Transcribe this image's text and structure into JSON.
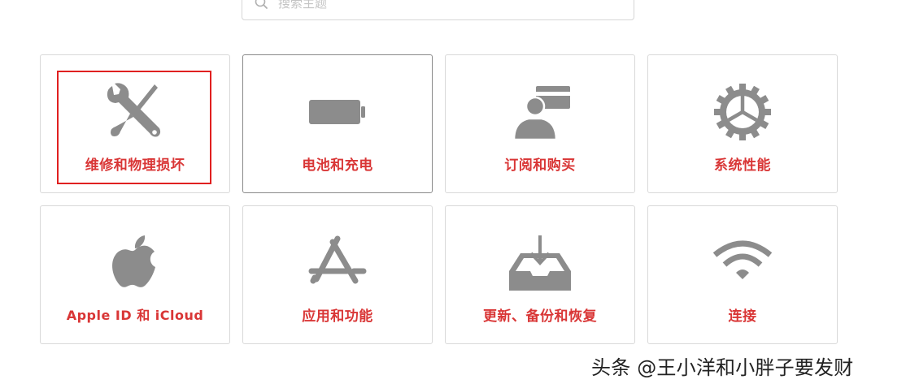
{
  "search": {
    "placeholder": "搜索主题"
  },
  "tiles": [
    {
      "label": "维修和物理损坏",
      "icon": "wrench-screwdriver-icon",
      "highlighted": true
    },
    {
      "label": "电池和充电",
      "icon": "battery-icon"
    },
    {
      "label": "订阅和购买",
      "icon": "person-card-icon"
    },
    {
      "label": "系统性能",
      "icon": "gear-icon"
    },
    {
      "label": "Apple ID 和 iCloud",
      "icon": "apple-logo-icon"
    },
    {
      "label": "应用和功能",
      "icon": "app-store-icon"
    },
    {
      "label": "更新、备份和恢复",
      "icon": "download-tray-icon"
    },
    {
      "label": "连接",
      "icon": "wifi-icon"
    }
  ],
  "colors": {
    "label": "#d93636",
    "icon": "#8c8c8c",
    "border": "#d9d9d9",
    "highlight": "#e02020"
  },
  "watermark": {
    "text": "头条 @王小洋和小胖子要发财"
  }
}
